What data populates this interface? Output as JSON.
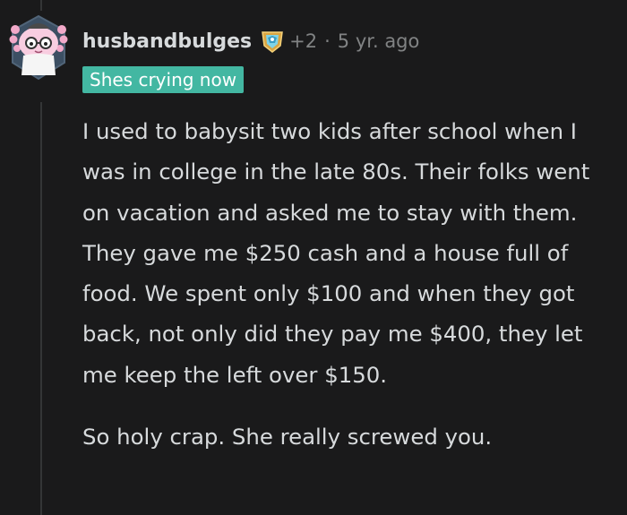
{
  "comment": {
    "author": "husbandbulges",
    "award_icon": "award-shield-icon",
    "award_count": "+2",
    "separator": "·",
    "timestamp": "5 yr. ago",
    "flair": "Shes crying now",
    "paragraphs": [
      "I used to babysit two kids after school when I was in college in the late 80s. Their folks went on vacation and asked me to stay with them. They gave me $250 cash and a house full of food. We spent only $100 and when they got back, not only did they pay me $400, they let me keep the left over $150.",
      "So holy crap. She really screwed you."
    ]
  },
  "colors": {
    "background": "#1a1a1b",
    "text": "#d7dadc",
    "meta": "#818384",
    "flair_bg": "#43b7a2",
    "thread_line": "#343536"
  }
}
